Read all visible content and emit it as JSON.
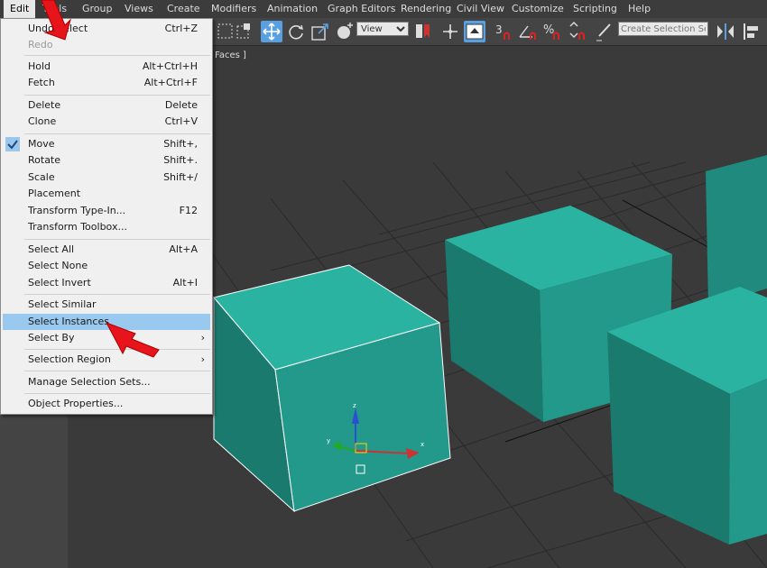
{
  "menubar": [
    "Edit",
    "Tools",
    "Group",
    "Views",
    "Create",
    "Modifiers",
    "Animation",
    "Graph Editors",
    "Rendering",
    "Civil View",
    "Customize",
    "Scripting",
    "Help"
  ],
  "toolbar": {
    "ref_coord": "View",
    "selection_set_placeholder": "Create Selection Se",
    "snap_labels": [
      "3",
      "%"
    ]
  },
  "viewport": {
    "label": "Faces ]",
    "gizmo": {
      "z": "z",
      "x": "x",
      "y": "y"
    },
    "object_color": "#2aaa99"
  },
  "edit_menu": {
    "rows": [
      {
        "label": "Undo Select",
        "shortcut": "Ctrl+Z"
      },
      {
        "label": "Redo",
        "shortcut": "",
        "disabled": true
      },
      {
        "label": "Hold",
        "shortcut": "Alt+Ctrl+H"
      },
      {
        "label": "Fetch",
        "shortcut": "Alt+Ctrl+F"
      },
      {
        "label": "Delete",
        "shortcut": "Delete"
      },
      {
        "label": "Clone",
        "shortcut": "Ctrl+V"
      },
      {
        "label": "Move",
        "shortcut": "Shift+,",
        "checked": true
      },
      {
        "label": "Rotate",
        "shortcut": "Shift+."
      },
      {
        "label": "Scale",
        "shortcut": "Shift+/"
      },
      {
        "label": "Placement",
        "shortcut": ""
      },
      {
        "label": "Transform Type-In...",
        "shortcut": "F12"
      },
      {
        "label": "Transform Toolbox...",
        "shortcut": ""
      },
      {
        "label": "Select All",
        "shortcut": "Alt+A"
      },
      {
        "label": "Select None",
        "shortcut": ""
      },
      {
        "label": "Select Invert",
        "shortcut": "Alt+I"
      },
      {
        "label": "Select Similar",
        "shortcut": ""
      },
      {
        "label": "Select Instances",
        "shortcut": "",
        "highlighted": true
      },
      {
        "label": "Select By",
        "shortcut": "",
        "submenu": true
      },
      {
        "label": "Selection Region",
        "shortcut": "",
        "submenu": true
      },
      {
        "label": "Manage Selection Sets...",
        "shortcut": ""
      },
      {
        "label": "Object Properties...",
        "shortcut": ""
      }
    ],
    "submenu_glyph": "›",
    "check_glyph": "✓"
  },
  "colors": {
    "menu_highlight": "#99c9ef",
    "arrow": "#e8141c",
    "selected_tool": "#5aa0e0"
  }
}
